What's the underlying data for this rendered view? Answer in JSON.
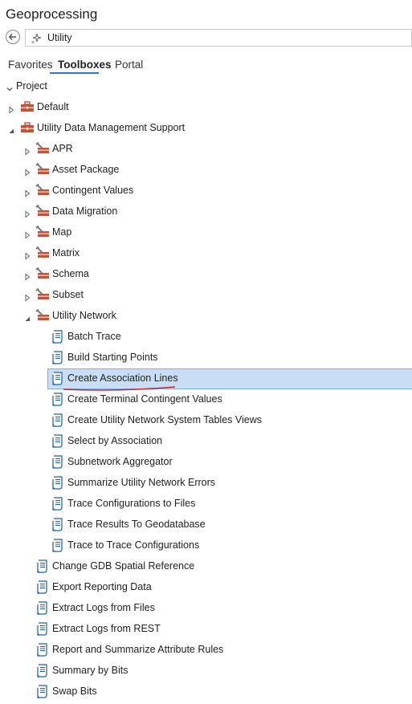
{
  "panel": {
    "title": "Geoprocessing"
  },
  "search": {
    "value": "Utility"
  },
  "tabs": [
    {
      "label": "Favorites",
      "active": false
    },
    {
      "label": "Toolboxes",
      "active": true
    },
    {
      "label": "Portal",
      "active": false
    }
  ],
  "tree": {
    "project_label": "Project",
    "default_label": "Default",
    "udms_label": "Utility Data Management Support",
    "toolsets": [
      "APR",
      "Asset Package",
      "Contingent Values",
      "Data Migration",
      "Map",
      "Matrix",
      "Schema",
      "Subset"
    ],
    "utility_network_label": "Utility Network",
    "un_tools": [
      "Batch Trace",
      "Build Starting Points",
      "Create Association Lines",
      "Create Terminal Contingent Values",
      "Create Utility Network System Tables Views",
      "Select by Association",
      "Subnetwork Aggregator",
      "Summarize Utility Network Errors",
      "Trace Configurations to Files",
      "Trace Results To Geodatabase",
      "Trace to Trace Configurations"
    ],
    "selected_tool": "Create Association Lines",
    "other_tools": [
      "Change GDB Spatial Reference",
      "Export Reporting Data",
      "Extract Logs from Files",
      "Extract Logs from REST",
      "Report and Summarize Attribute Rules",
      "Summary by Bits",
      "Swap Bits"
    ]
  },
  "colors": {
    "selection": "#c9def5",
    "selection_border": "#7bb0e6",
    "toolbox": "#c0533a",
    "tool_icon": "#1f5fa8",
    "annotation": "#d32020"
  }
}
